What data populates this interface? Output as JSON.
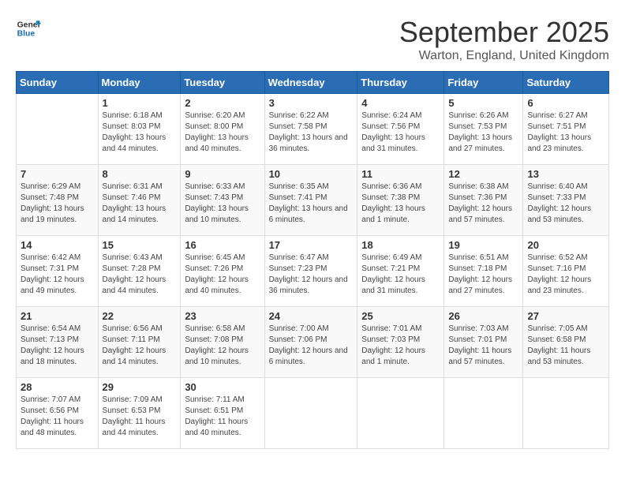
{
  "logo": {
    "line1": "General",
    "line2": "Blue"
  },
  "title": "September 2025",
  "location": "Warton, England, United Kingdom",
  "days_of_week": [
    "Sunday",
    "Monday",
    "Tuesday",
    "Wednesday",
    "Thursday",
    "Friday",
    "Saturday"
  ],
  "weeks": [
    [
      {
        "day": "",
        "sunrise": "",
        "sunset": "",
        "daylight": ""
      },
      {
        "day": "1",
        "sunrise": "Sunrise: 6:18 AM",
        "sunset": "Sunset: 8:03 PM",
        "daylight": "Daylight: 13 hours and 44 minutes."
      },
      {
        "day": "2",
        "sunrise": "Sunrise: 6:20 AM",
        "sunset": "Sunset: 8:00 PM",
        "daylight": "Daylight: 13 hours and 40 minutes."
      },
      {
        "day": "3",
        "sunrise": "Sunrise: 6:22 AM",
        "sunset": "Sunset: 7:58 PM",
        "daylight": "Daylight: 13 hours and 36 minutes."
      },
      {
        "day": "4",
        "sunrise": "Sunrise: 6:24 AM",
        "sunset": "Sunset: 7:56 PM",
        "daylight": "Daylight: 13 hours and 31 minutes."
      },
      {
        "day": "5",
        "sunrise": "Sunrise: 6:26 AM",
        "sunset": "Sunset: 7:53 PM",
        "daylight": "Daylight: 13 hours and 27 minutes."
      },
      {
        "day": "6",
        "sunrise": "Sunrise: 6:27 AM",
        "sunset": "Sunset: 7:51 PM",
        "daylight": "Daylight: 13 hours and 23 minutes."
      }
    ],
    [
      {
        "day": "7",
        "sunrise": "Sunrise: 6:29 AM",
        "sunset": "Sunset: 7:48 PM",
        "daylight": "Daylight: 13 hours and 19 minutes."
      },
      {
        "day": "8",
        "sunrise": "Sunrise: 6:31 AM",
        "sunset": "Sunset: 7:46 PM",
        "daylight": "Daylight: 13 hours and 14 minutes."
      },
      {
        "day": "9",
        "sunrise": "Sunrise: 6:33 AM",
        "sunset": "Sunset: 7:43 PM",
        "daylight": "Daylight: 13 hours and 10 minutes."
      },
      {
        "day": "10",
        "sunrise": "Sunrise: 6:35 AM",
        "sunset": "Sunset: 7:41 PM",
        "daylight": "Daylight: 13 hours and 6 minutes."
      },
      {
        "day": "11",
        "sunrise": "Sunrise: 6:36 AM",
        "sunset": "Sunset: 7:38 PM",
        "daylight": "Daylight: 13 hours and 1 minute."
      },
      {
        "day": "12",
        "sunrise": "Sunrise: 6:38 AM",
        "sunset": "Sunset: 7:36 PM",
        "daylight": "Daylight: 12 hours and 57 minutes."
      },
      {
        "day": "13",
        "sunrise": "Sunrise: 6:40 AM",
        "sunset": "Sunset: 7:33 PM",
        "daylight": "Daylight: 12 hours and 53 minutes."
      }
    ],
    [
      {
        "day": "14",
        "sunrise": "Sunrise: 6:42 AM",
        "sunset": "Sunset: 7:31 PM",
        "daylight": "Daylight: 12 hours and 49 minutes."
      },
      {
        "day": "15",
        "sunrise": "Sunrise: 6:43 AM",
        "sunset": "Sunset: 7:28 PM",
        "daylight": "Daylight: 12 hours and 44 minutes."
      },
      {
        "day": "16",
        "sunrise": "Sunrise: 6:45 AM",
        "sunset": "Sunset: 7:26 PM",
        "daylight": "Daylight: 12 hours and 40 minutes."
      },
      {
        "day": "17",
        "sunrise": "Sunrise: 6:47 AM",
        "sunset": "Sunset: 7:23 PM",
        "daylight": "Daylight: 12 hours and 36 minutes."
      },
      {
        "day": "18",
        "sunrise": "Sunrise: 6:49 AM",
        "sunset": "Sunset: 7:21 PM",
        "daylight": "Daylight: 12 hours and 31 minutes."
      },
      {
        "day": "19",
        "sunrise": "Sunrise: 6:51 AM",
        "sunset": "Sunset: 7:18 PM",
        "daylight": "Daylight: 12 hours and 27 minutes."
      },
      {
        "day": "20",
        "sunrise": "Sunrise: 6:52 AM",
        "sunset": "Sunset: 7:16 PM",
        "daylight": "Daylight: 12 hours and 23 minutes."
      }
    ],
    [
      {
        "day": "21",
        "sunrise": "Sunrise: 6:54 AM",
        "sunset": "Sunset: 7:13 PM",
        "daylight": "Daylight: 12 hours and 18 minutes."
      },
      {
        "day": "22",
        "sunrise": "Sunrise: 6:56 AM",
        "sunset": "Sunset: 7:11 PM",
        "daylight": "Daylight: 12 hours and 14 minutes."
      },
      {
        "day": "23",
        "sunrise": "Sunrise: 6:58 AM",
        "sunset": "Sunset: 7:08 PM",
        "daylight": "Daylight: 12 hours and 10 minutes."
      },
      {
        "day": "24",
        "sunrise": "Sunrise: 7:00 AM",
        "sunset": "Sunset: 7:06 PM",
        "daylight": "Daylight: 12 hours and 6 minutes."
      },
      {
        "day": "25",
        "sunrise": "Sunrise: 7:01 AM",
        "sunset": "Sunset: 7:03 PM",
        "daylight": "Daylight: 12 hours and 1 minute."
      },
      {
        "day": "26",
        "sunrise": "Sunrise: 7:03 AM",
        "sunset": "Sunset: 7:01 PM",
        "daylight": "Daylight: 11 hours and 57 minutes."
      },
      {
        "day": "27",
        "sunrise": "Sunrise: 7:05 AM",
        "sunset": "Sunset: 6:58 PM",
        "daylight": "Daylight: 11 hours and 53 minutes."
      }
    ],
    [
      {
        "day": "28",
        "sunrise": "Sunrise: 7:07 AM",
        "sunset": "Sunset: 6:56 PM",
        "daylight": "Daylight: 11 hours and 48 minutes."
      },
      {
        "day": "29",
        "sunrise": "Sunrise: 7:09 AM",
        "sunset": "Sunset: 6:53 PM",
        "daylight": "Daylight: 11 hours and 44 minutes."
      },
      {
        "day": "30",
        "sunrise": "Sunrise: 7:11 AM",
        "sunset": "Sunset: 6:51 PM",
        "daylight": "Daylight: 11 hours and 40 minutes."
      },
      {
        "day": "",
        "sunrise": "",
        "sunset": "",
        "daylight": ""
      },
      {
        "day": "",
        "sunrise": "",
        "sunset": "",
        "daylight": ""
      },
      {
        "day": "",
        "sunrise": "",
        "sunset": "",
        "daylight": ""
      },
      {
        "day": "",
        "sunrise": "",
        "sunset": "",
        "daylight": ""
      }
    ]
  ]
}
